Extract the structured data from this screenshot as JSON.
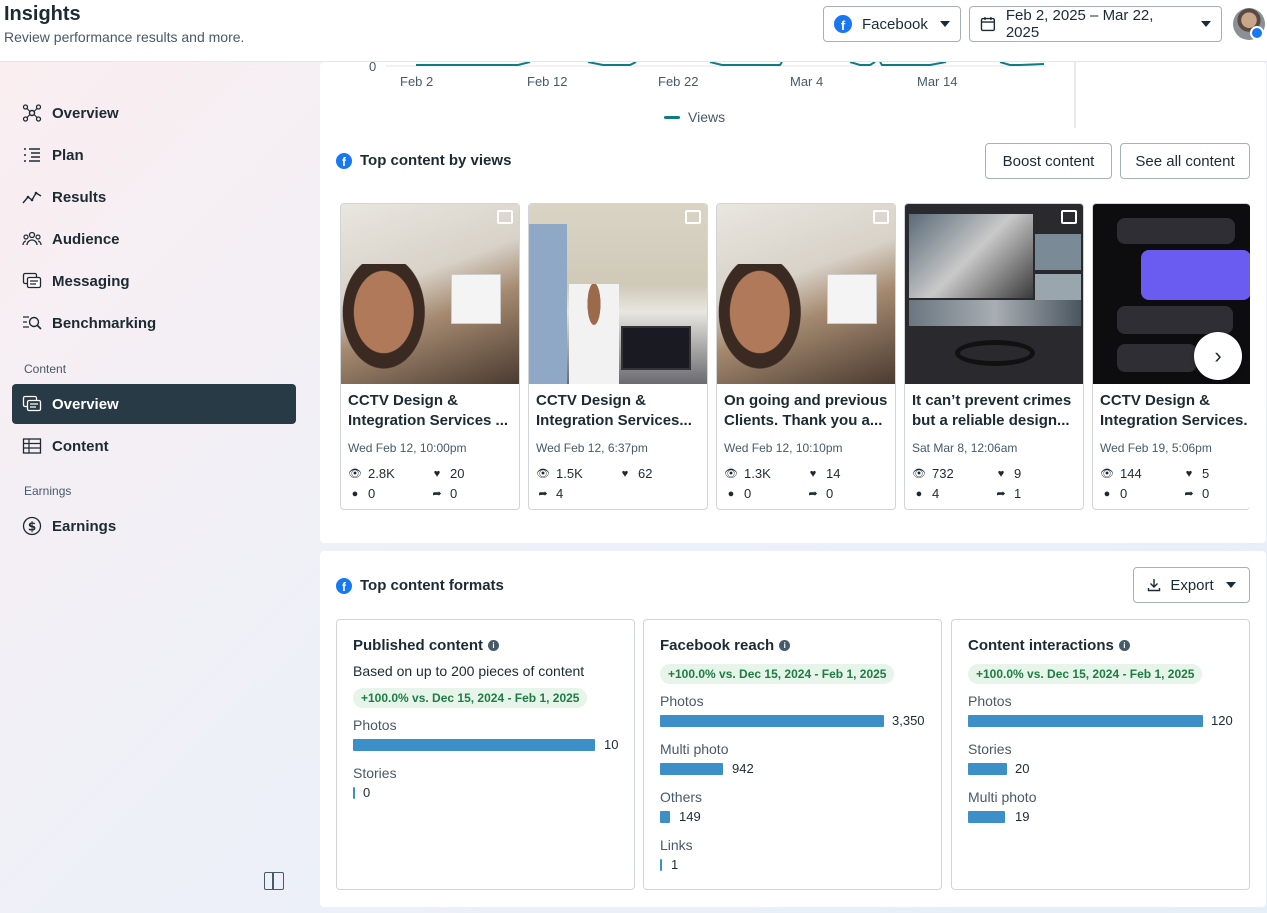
{
  "header": {
    "title": "Insights",
    "subtitle": "Review performance results and more.",
    "platform": "Facebook",
    "date_range": "Feb 2, 2025 – Mar 22, 2025"
  },
  "sidebar": {
    "items": [
      {
        "label": "Overview",
        "icon": "overview-icon"
      },
      {
        "label": "Plan",
        "icon": "plan-icon"
      },
      {
        "label": "Results",
        "icon": "results-icon"
      },
      {
        "label": "Audience",
        "icon": "audience-icon"
      },
      {
        "label": "Messaging",
        "icon": "messaging-icon"
      },
      {
        "label": "Benchmarking",
        "icon": "benchmarking-icon"
      }
    ],
    "content_section": "Content",
    "content_items": [
      {
        "label": "Overview",
        "active": true
      },
      {
        "label": "Content"
      }
    ],
    "earnings_section": "Earnings",
    "earnings_items": [
      {
        "label": "Earnings"
      }
    ]
  },
  "chart": {
    "y_zero": "0",
    "x_ticks": [
      "Feb 2",
      "Feb 12",
      "Feb 22",
      "Mar 4",
      "Mar 14"
    ],
    "legend": "Views",
    "series_color": "#0f7c82"
  },
  "top_content": {
    "title": "Top content by views",
    "boost_label": "Boost content",
    "see_all_label": "See all content",
    "items": [
      {
        "title_line1": "CCTV Design &",
        "title_line2": "Integration Services ...",
        "date": "Wed Feb 12, 10:00pm",
        "views": "2.8K",
        "likes": "20",
        "comments": "0",
        "shares": "0"
      },
      {
        "title_line1": "CCTV Design &",
        "title_line2": "Integration Services...",
        "date": "Wed Feb 12, 6:37pm",
        "views": "1.5K",
        "likes": "62",
        "comments": "",
        "shares": "4"
      },
      {
        "title_line1": "On going and previous",
        "title_line2": "Clients. Thank you a...",
        "date": "Wed Feb 12, 10:10pm",
        "views": "1.3K",
        "likes": "14",
        "comments": "0",
        "shares": "0"
      },
      {
        "title_line1": "It can’t prevent crimes",
        "title_line2": "but a reliable design...",
        "date": "Sat Mar 8, 12:06am",
        "views": "732",
        "likes": "9",
        "comments": "4",
        "shares": "1"
      },
      {
        "title_line1": "CCTV Design &",
        "title_line2": "Integration Services.",
        "date": "Wed Feb 19, 5:06pm",
        "views": "144",
        "likes": "5",
        "comments": "0",
        "shares": "0"
      }
    ]
  },
  "formats": {
    "title": "Top content formats",
    "export_label": "Export",
    "published": {
      "title": "Published content",
      "note": "Based on up to 200 pieces of content",
      "badge": "+100.0% vs. Dec 15, 2024 - Feb 1, 2025",
      "rows": [
        {
          "label": "Photos",
          "value": "10",
          "fraction": 1.0
        },
        {
          "label": "Stories",
          "value": "0",
          "fraction": 0.0
        }
      ]
    },
    "reach": {
      "title": "Facebook reach",
      "badge": "+100.0% vs. Dec 15, 2024 - Feb 1, 2025",
      "rows": [
        {
          "label": "Photos",
          "value": "3,350",
          "fraction": 1.0
        },
        {
          "label": "Multi photo",
          "value": "942",
          "fraction": 0.281
        },
        {
          "label": "Others",
          "value": "149",
          "fraction": 0.044
        },
        {
          "label": "Links",
          "value": "1",
          "fraction": 0.0003
        }
      ]
    },
    "interactions": {
      "title": "Content interactions",
      "badge": "+100.0% vs. Dec 15, 2024 - Feb 1, 2025",
      "rows": [
        {
          "label": "Photos",
          "value": "120",
          "fraction": 1.0
        },
        {
          "label": "Stories",
          "value": "20",
          "fraction": 0.167
        },
        {
          "label": "Multi photo",
          "value": "19",
          "fraction": 0.158
        }
      ]
    }
  }
}
